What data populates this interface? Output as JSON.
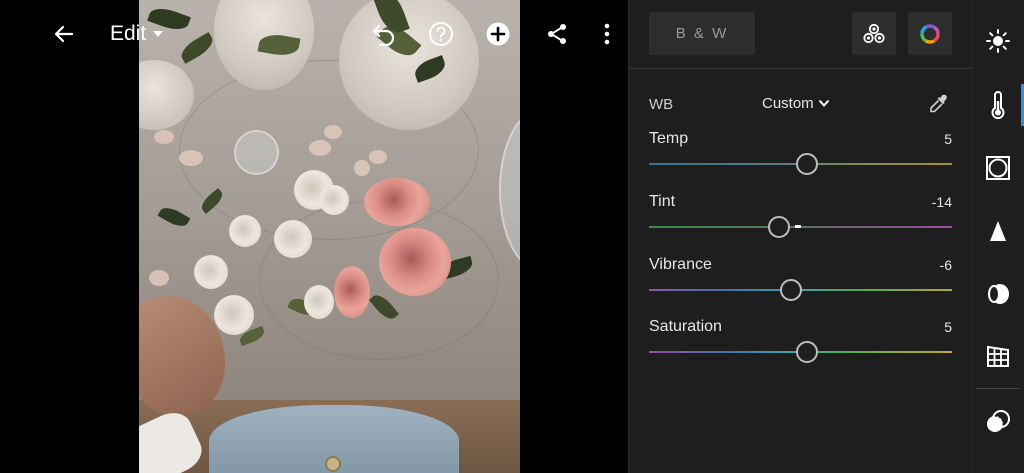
{
  "toolbar": {
    "edit_label": "Edit"
  },
  "panel": {
    "bw_label": "B & W",
    "wb": {
      "label": "WB",
      "selected": "Custom"
    },
    "sliders": [
      {
        "label": "Temp",
        "value": "5",
        "position": 0.52
      },
      {
        "label": "Tint",
        "value": "-14",
        "position": 0.43
      },
      {
        "label": "Vibrance",
        "value": "-6",
        "position": 0.47
      },
      {
        "label": "Saturation",
        "value": "5",
        "position": 0.52
      }
    ]
  },
  "rail": {
    "active_item": "color"
  },
  "colors": {
    "accent": "#2f8fe6",
    "panel_bg": "#1e1e1e",
    "button_bg": "#2d2d2d"
  },
  "icons": {
    "toolbar": [
      "back-arrow-icon",
      "chevron-down-icon",
      "undo-icon",
      "help-icon",
      "add-circle-icon",
      "share-icon",
      "more-vertical-icon"
    ],
    "panel": [
      "profiles-icon",
      "color-wheel-icon",
      "eyedropper-icon",
      "chevron-down-icon"
    ],
    "rail": [
      "light-icon",
      "color-thermometer-icon",
      "effects-icon",
      "detail-icon",
      "optics-icon",
      "geometry-icon",
      "mask-icon"
    ]
  }
}
